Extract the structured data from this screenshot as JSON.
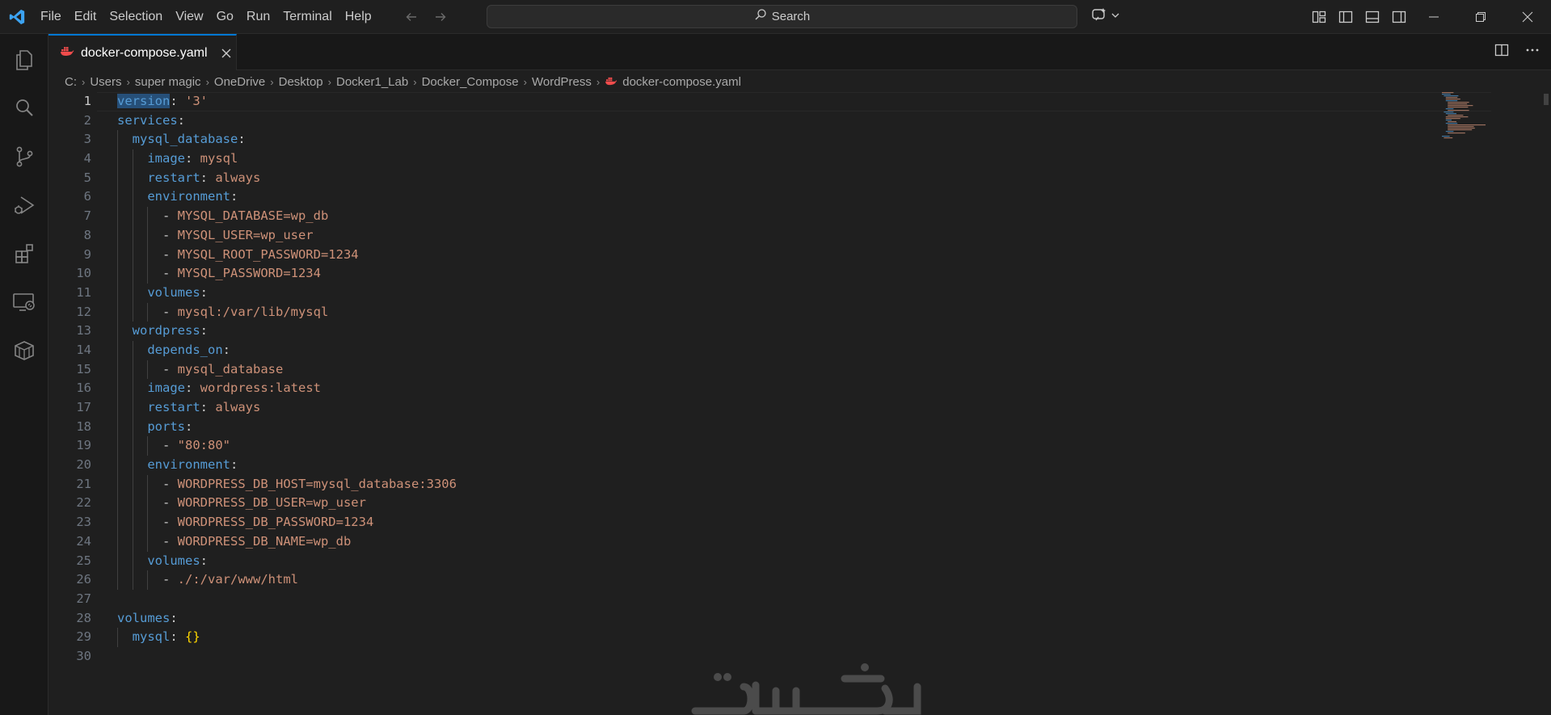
{
  "menu": [
    "File",
    "Edit",
    "Selection",
    "View",
    "Go",
    "Run",
    "Terminal",
    "Help"
  ],
  "search": {
    "label": "Search"
  },
  "colors": {
    "accent": "#0078d4",
    "keyword": "#569cd6",
    "string": "#ce9178",
    "bracket": "#ffd700",
    "docker": "#f14c4c"
  },
  "icons": {
    "activity": [
      "explorer-icon",
      "search-icon",
      "source-control-icon",
      "run-debug-icon",
      "extensions-icon",
      "remote-explorer-icon",
      "containers-icon"
    ]
  },
  "tab": {
    "label": "docker-compose.yaml",
    "icon": "docker-icon"
  },
  "breadcrumbs": [
    "C:",
    "Users",
    "super magic",
    "OneDrive",
    "Desktop",
    "Docker1_Lab",
    "Docker_Compose",
    "WordPress"
  ],
  "breadcrumb_file": "docker-compose.yaml",
  "active_line": 1,
  "selection": "version",
  "lines": [
    {
      "n": "1",
      "indent": "",
      "key": "version",
      "sep": ": ",
      "val": "'3'",
      "vclass": "s"
    },
    {
      "n": "2",
      "indent": "",
      "key": "services",
      "sep": ":",
      "val": "",
      "vclass": "s"
    },
    {
      "n": "3",
      "indent": "  ",
      "key": "mysql_database",
      "sep": ":",
      "val": "",
      "vclass": "s"
    },
    {
      "n": "4",
      "indent": "    ",
      "key": "image",
      "sep": ": ",
      "val": "mysql",
      "vclass": "s"
    },
    {
      "n": "5",
      "indent": "    ",
      "key": "restart",
      "sep": ": ",
      "val": "always",
      "vclass": "s"
    },
    {
      "n": "6",
      "indent": "    ",
      "key": "environment",
      "sep": ":",
      "val": "",
      "vclass": "s"
    },
    {
      "n": "7",
      "indent": "      ",
      "key": "",
      "sep": "- ",
      "val": "MYSQL_DATABASE=wp_db",
      "vclass": "s"
    },
    {
      "n": "8",
      "indent": "      ",
      "key": "",
      "sep": "- ",
      "val": "MYSQL_USER=wp_user",
      "vclass": "s"
    },
    {
      "n": "9",
      "indent": "      ",
      "key": "",
      "sep": "- ",
      "val": "MYSQL_ROOT_PASSWORD=1234",
      "vclass": "s"
    },
    {
      "n": "10",
      "indent": "      ",
      "key": "",
      "sep": "- ",
      "val": "MYSQL_PASSWORD=1234",
      "vclass": "s"
    },
    {
      "n": "11",
      "indent": "    ",
      "key": "volumes",
      "sep": ":",
      "val": "",
      "vclass": "s"
    },
    {
      "n": "12",
      "indent": "      ",
      "key": "",
      "sep": "- ",
      "val": "mysql:/var/lib/mysql",
      "vclass": "s"
    },
    {
      "n": "13",
      "indent": "  ",
      "key": "wordpress",
      "sep": ":",
      "val": "",
      "vclass": "s"
    },
    {
      "n": "14",
      "indent": "    ",
      "key": "depends_on",
      "sep": ":",
      "val": "",
      "vclass": "s"
    },
    {
      "n": "15",
      "indent": "      ",
      "key": "",
      "sep": "- ",
      "val": "mysql_database",
      "vclass": "s"
    },
    {
      "n": "16",
      "indent": "    ",
      "key": "image",
      "sep": ": ",
      "val": "wordpress:latest",
      "vclass": "s"
    },
    {
      "n": "17",
      "indent": "    ",
      "key": "restart",
      "sep": ": ",
      "val": "always",
      "vclass": "s"
    },
    {
      "n": "18",
      "indent": "    ",
      "key": "ports",
      "sep": ":",
      "val": "",
      "vclass": "s"
    },
    {
      "n": "19",
      "indent": "      ",
      "key": "",
      "sep": "- ",
      "val": "\"80:80\"",
      "vclass": "s"
    },
    {
      "n": "20",
      "indent": "    ",
      "key": "environment",
      "sep": ":",
      "val": "",
      "vclass": "s"
    },
    {
      "n": "21",
      "indent": "      ",
      "key": "",
      "sep": "- ",
      "val": "WORDPRESS_DB_HOST=mysql_database:3306",
      "vclass": "s"
    },
    {
      "n": "22",
      "indent": "      ",
      "key": "",
      "sep": "- ",
      "val": "WORDPRESS_DB_USER=wp_user",
      "vclass": "s"
    },
    {
      "n": "23",
      "indent": "      ",
      "key": "",
      "sep": "- ",
      "val": "WORDPRESS_DB_PASSWORD=1234",
      "vclass": "s"
    },
    {
      "n": "24",
      "indent": "      ",
      "key": "",
      "sep": "- ",
      "val": "WORDPRESS_DB_NAME=wp_db",
      "vclass": "s"
    },
    {
      "n": "25",
      "indent": "    ",
      "key": "volumes",
      "sep": ":",
      "val": "",
      "vclass": "s"
    },
    {
      "n": "26",
      "indent": "      ",
      "key": "",
      "sep": "- ",
      "val": "./:/var/www/html",
      "vclass": "s"
    },
    {
      "n": "27",
      "indent": "",
      "key": "",
      "sep": "",
      "val": "",
      "vclass": "s"
    },
    {
      "n": "28",
      "indent": "",
      "key": "volumes",
      "sep": ":",
      "val": "",
      "vclass": "s"
    },
    {
      "n": "29",
      "indent": "  ",
      "key": "mysql",
      "sep": ": ",
      "val": "{}",
      "vclass": "b"
    },
    {
      "n": "30",
      "indent": "",
      "key": "",
      "sep": "",
      "val": "",
      "vclass": "s"
    }
  ]
}
